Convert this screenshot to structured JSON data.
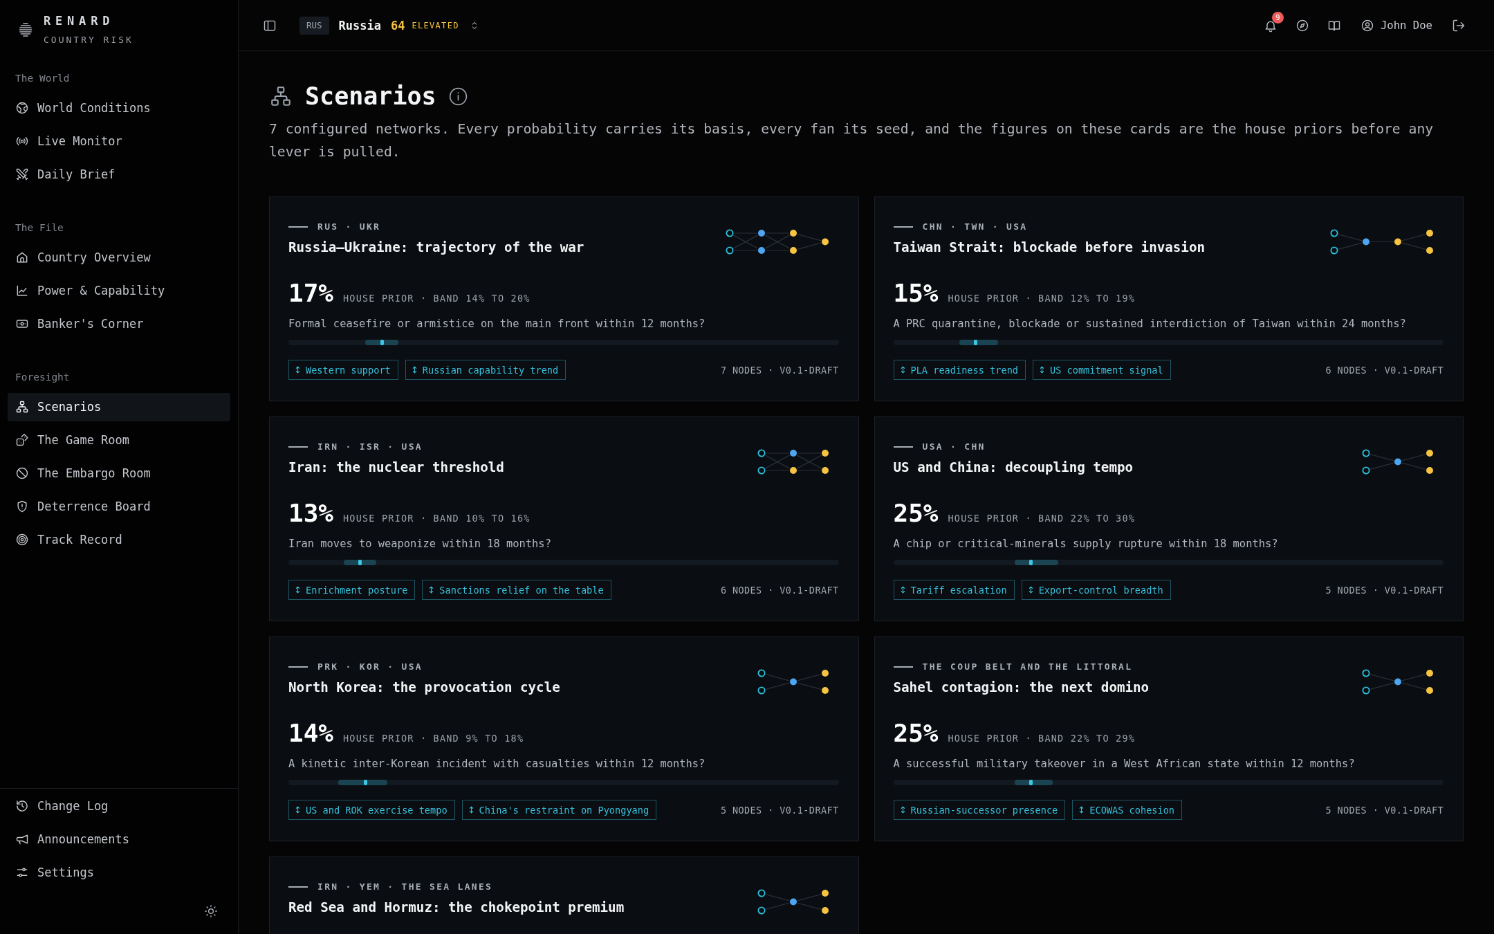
{
  "sidebar": {
    "brand": {
      "name": "RENARD",
      "tagline": "COUNTRY RISK"
    },
    "sections": [
      {
        "title": "The World",
        "items": [
          {
            "label": "World Conditions",
            "selected": false
          },
          {
            "label": "Live Monitor",
            "selected": false
          },
          {
            "label": "Daily Brief",
            "selected": false
          }
        ]
      },
      {
        "title": "The File",
        "items": [
          {
            "label": "Country Overview",
            "selected": false
          },
          {
            "label": "Power & Capability",
            "selected": false
          },
          {
            "label": "Banker's Corner",
            "selected": false
          }
        ]
      },
      {
        "title": "Foresight",
        "items": [
          {
            "label": "Scenarios",
            "selected": true
          },
          {
            "label": "The Game Room",
            "selected": false
          },
          {
            "label": "The Embargo Room",
            "selected": false
          },
          {
            "label": "Deterrence Board",
            "selected": false
          },
          {
            "label": "Track Record",
            "selected": false
          }
        ]
      }
    ],
    "footer_items": [
      {
        "label": "Change Log",
        "selected": false
      },
      {
        "label": "Announcements",
        "selected": false
      },
      {
        "label": "Settings",
        "selected": false
      }
    ]
  },
  "topbar": {
    "country": {
      "code": "RUS",
      "name": "Russia",
      "score": "64",
      "rating": "ELEVATED"
    },
    "notifications": "9",
    "user": "John Doe"
  },
  "page": {
    "title": "Scenarios",
    "description": "7 configured networks. Every probability carries its basis, every fan its seed, and the figures on these cards are the house priors before any lever is pulled."
  },
  "scenarios": [
    {
      "countries": "RUS · UKR",
      "title": "Russia–Ukraine: trajectory of the war",
      "probability": "17%",
      "basis": "HOUSE PRIOR · BAND 14% TO 20%",
      "question": "Formal ceasefire or armistice on the main front within 12 months?",
      "meter": {
        "level": 0.17,
        "band": [
          {
            "level": 0.14
          },
          {
            "level": 0.2
          }
        ]
      },
      "levers": [
        "Western support",
        "Russian capability trend"
      ],
      "meta": "7 NODES · V0.1-DRAFT",
      "network": [
        [
          {
            "kind": "lever"
          },
          {
            "kind": "lever"
          }
        ],
        [
          {
            "kind": "driver"
          },
          {
            "kind": "driver"
          }
        ],
        [
          {
            "kind": "outcome"
          },
          {
            "kind": "outcome"
          }
        ],
        [
          {
            "kind": "outcome"
          }
        ]
      ]
    },
    {
      "countries": "CHN · TWN · USA",
      "title": "Taiwan Strait: blockade before invasion",
      "probability": "15%",
      "basis": "HOUSE PRIOR · BAND 12% TO 19%",
      "question": "A PRC quarantine, blockade or sustained interdiction of Taiwan within 24 months?",
      "meter": {
        "level": 0.15,
        "band": [
          {
            "level": 0.12
          },
          {
            "level": 0.19
          }
        ]
      },
      "levers": [
        "PLA readiness trend",
        "US commitment signal"
      ],
      "meta": "6 NODES · V0.1-DRAFT",
      "network": [
        [
          {
            "kind": "lever"
          },
          {
            "kind": "lever"
          }
        ],
        [
          {
            "kind": "driver"
          }
        ],
        [
          {
            "kind": "outcome"
          }
        ],
        [
          {
            "kind": "outcome"
          },
          {
            "kind": "outcome"
          }
        ]
      ]
    },
    {
      "countries": "IRN · ISR · USA",
      "title": "Iran: the nuclear threshold",
      "probability": "13%",
      "basis": "HOUSE PRIOR · BAND 10% TO 16%",
      "question": "Iran moves to weaponize within 18 months?",
      "meter": {
        "level": 0.13,
        "band": [
          {
            "level": 0.1
          },
          {
            "level": 0.16
          }
        ]
      },
      "levers": [
        "Enrichment posture",
        "Sanctions relief on the table"
      ],
      "meta": "6 NODES · V0.1-DRAFT",
      "network": [
        [
          {
            "kind": "lever"
          },
          {
            "kind": "lever"
          }
        ],
        [
          {
            "kind": "driver"
          },
          {
            "kind": "outcome"
          }
        ],
        [
          {
            "kind": "outcome"
          },
          {
            "kind": "outcome"
          }
        ]
      ]
    },
    {
      "countries": "USA · CHN",
      "title": "US and China: decoupling tempo",
      "probability": "25%",
      "basis": "HOUSE PRIOR · BAND 22% TO 30%",
      "question": "A chip or critical-minerals supply rupture within 18 months?",
      "meter": {
        "level": 0.25,
        "band": [
          {
            "level": 0.22
          },
          {
            "level": 0.3
          }
        ]
      },
      "levers": [
        "Tariff escalation",
        "Export-control breadth"
      ],
      "meta": "5 NODES · V0.1-DRAFT",
      "network": [
        [
          {
            "kind": "lever"
          },
          {
            "kind": "lever"
          }
        ],
        [
          {
            "kind": "driver"
          }
        ],
        [
          {
            "kind": "outcome"
          },
          {
            "kind": "outcome"
          }
        ]
      ]
    },
    {
      "countries": "PRK · KOR · USA",
      "title": "North Korea: the provocation cycle",
      "probability": "14%",
      "basis": "HOUSE PRIOR · BAND 9% TO 18%",
      "question": "A kinetic inter-Korean incident with casualties within 12 months?",
      "meter": {
        "level": 0.14,
        "band": [
          {
            "level": 0.09
          },
          {
            "level": 0.18
          }
        ]
      },
      "levers": [
        "US and ROK exercise tempo",
        "China's restraint on Pyongyang"
      ],
      "meta": "5 NODES · V0.1-DRAFT",
      "network": [
        [
          {
            "kind": "lever"
          },
          {
            "kind": "lever"
          }
        ],
        [
          {
            "kind": "driver"
          }
        ],
        [
          {
            "kind": "outcome"
          },
          {
            "kind": "outcome"
          }
        ]
      ]
    },
    {
      "countries": "THE COUP BELT AND THE LITTORAL",
      "title": "Sahel contagion: the next domino",
      "probability": "25%",
      "basis": "HOUSE PRIOR · BAND 22% TO 29%",
      "question": "A successful military takeover in a West African state within 12 months?",
      "meter": {
        "level": 0.25,
        "band": [
          {
            "level": 0.22
          },
          {
            "level": 0.29
          }
        ]
      },
      "levers": [
        "Russian-successor presence",
        "ECOWAS cohesion"
      ],
      "meta": "5 NODES · V0.1-DRAFT",
      "network": [
        [
          {
            "kind": "lever"
          },
          {
            "kind": "lever"
          }
        ],
        [
          {
            "kind": "driver"
          }
        ],
        [
          {
            "kind": "outcome"
          },
          {
            "kind": "outcome"
          }
        ]
      ]
    },
    {
      "countries": "IRN · YEM · THE SEA LANES",
      "title": "Red Sea and Hormuz: the chokepoint premium",
      "network": [
        [
          {
            "kind": "lever"
          },
          {
            "kind": "lever"
          }
        ],
        [
          {
            "kind": "driver"
          }
        ],
        [
          {
            "kind": "outcome"
          },
          {
            "kind": "outcome"
          }
        ]
      ]
    }
  ]
}
